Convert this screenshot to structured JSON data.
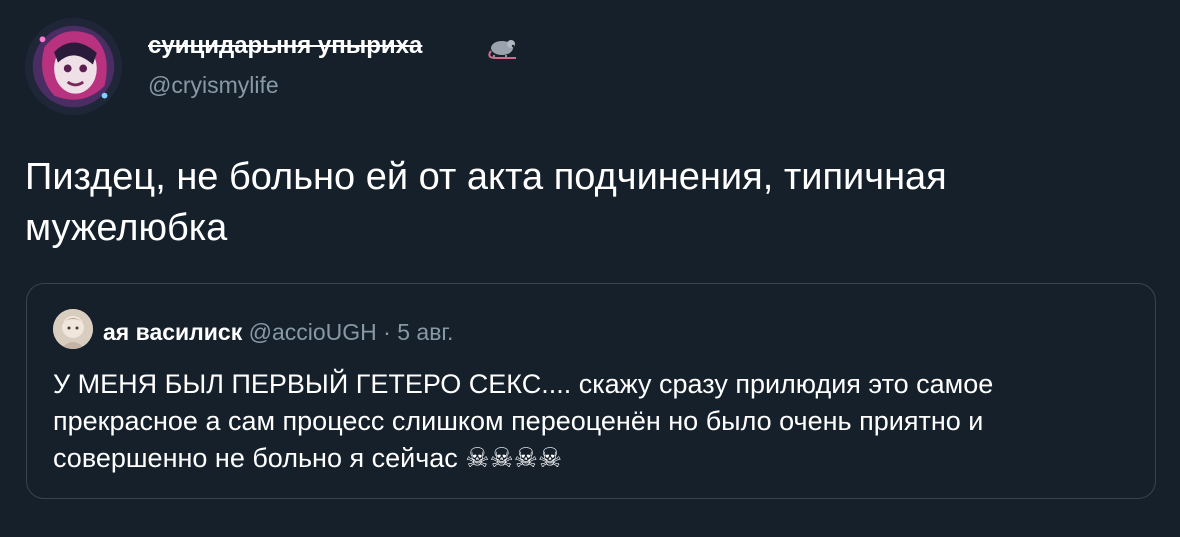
{
  "tweet": {
    "display_name": "суицидарыня упыриха",
    "handle": "@cryismylife",
    "text": "Пиздец, не больно ей от акта подчинения, типичная мужелюбка",
    "icons": {
      "avatar": "user-avatar",
      "name_badge": "rat-icon"
    }
  },
  "quote": {
    "display_name": "ая василиск",
    "handle": "@accioUGH",
    "separator": "·",
    "date": "5 авг.",
    "text": "У МЕНЯ БЫЛ ПЕРВЫЙ ГЕТЕРО СЕКС.... скажу сразу прилюдия это самое прекрасное а сам процесс слишком переоценён но было очень приятно и совершенно не больно я сейчас",
    "emoji": "☠☠☠☠"
  },
  "colors": {
    "background": "#15202b",
    "text": "#ffffff",
    "secondary": "#8899a6",
    "border": "#38444d"
  }
}
